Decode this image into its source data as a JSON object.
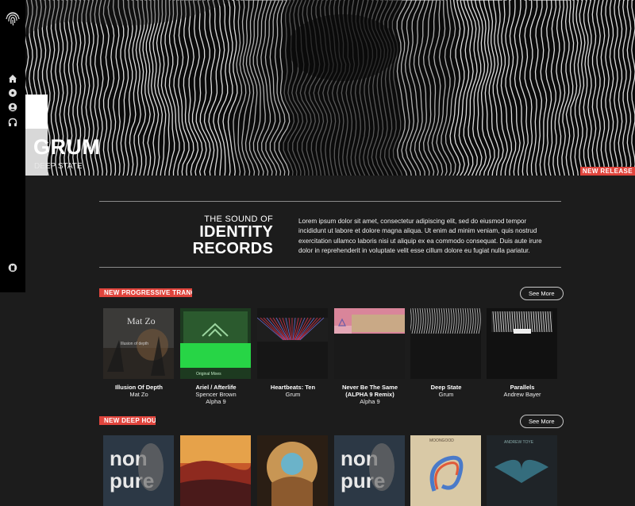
{
  "sidebar": {
    "icons": [
      "fingerprint-icon",
      "home-icon",
      "disc-icon",
      "user-icon",
      "headphones-icon",
      "github-icon"
    ]
  },
  "hero": {
    "title": "GRUM",
    "subtitle": "DEEP STATE",
    "badge": "NEW RELEASE"
  },
  "about": {
    "line1": "THE SOUND OF",
    "line2": "IDENTITY",
    "line3": "RECORDS",
    "body": "Lorem ipsum dolor sit amet, consectetur adipiscing elit, sed do eiusmod tempor incididunt ut labore et dolore magna aliqua. Ut enim ad minim veniam, quis nostrud exercitation ullamco laboris nisi ut aliquip ex ea commodo consequat. Duis aute irure dolor in reprehenderit in voluptate velit esse cillum dolore eu fugiat nulla pariatur."
  },
  "sections": [
    {
      "label": "NEW PROGRESSIVE TRANCE",
      "see_more": "See More",
      "cards": [
        {
          "title": "Illusion Of Depth",
          "artist": "Mat Zo",
          "cover_text": "Mat Zo",
          "cover_sub": "Illusion of depth"
        },
        {
          "title": "Ariel / Afterlife",
          "artist": "Spencer Brown\nAlpha 9",
          "cover_text": "Original Mixes"
        },
        {
          "title": "Heartbeats: Ten",
          "artist": "Grum"
        },
        {
          "title": "Never Be The Same (ALPHA 9 Remix)",
          "artist": "Alpha 9"
        },
        {
          "title": "Deep State",
          "artist": "Grum"
        },
        {
          "title": "Parallels",
          "artist": "Andrew Bayer"
        }
      ]
    },
    {
      "label": "NEW DEEP HOUSE",
      "see_more": "See More",
      "cards": [
        {
          "cover_text": "non pure"
        },
        {},
        {},
        {
          "cover_text": "non pure"
        },
        {
          "cover_text": "MOONGOOD"
        },
        {
          "cover_text": "ANDREW TOYE"
        }
      ]
    }
  ],
  "colors": {
    "accent": "#e0453d",
    "background": "#1c1c1c",
    "sidebar": "#000000"
  }
}
